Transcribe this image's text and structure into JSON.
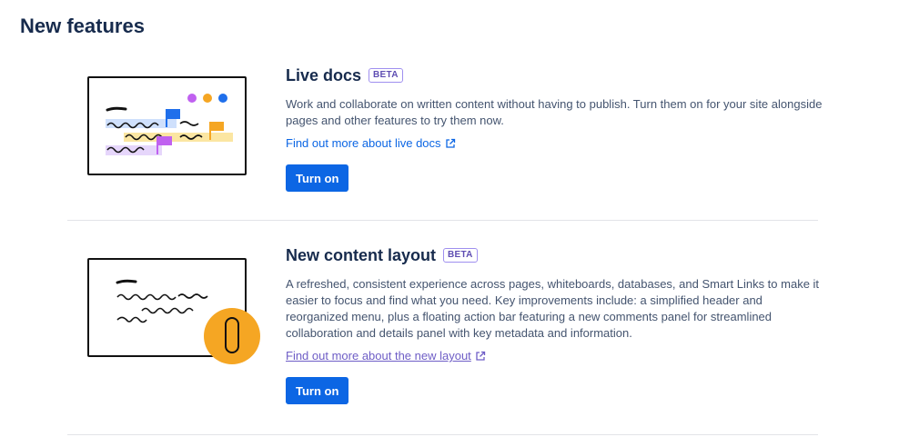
{
  "page": {
    "title": "New features"
  },
  "features": [
    {
      "title": "Live docs",
      "badge": "BETA",
      "description": "Work and collaborate on written content without having to publish. Turn them on for your site alongside pages and other features to try them now.",
      "link": "Find out more about live docs",
      "button": "Turn on",
      "illustration": "live-docs-illustration"
    },
    {
      "title": "New content layout",
      "badge": "BETA",
      "description": "A refreshed, consistent experience across pages, whiteboards, databases, and Smart Links to make it easier to focus and find what you need. Key improvements include: a simplified header and reorganized menu, plus a floating action bar featuring a new comments panel for streamlined collaboration and details panel with key metadata and information.",
      "link": "Find out more about the new layout",
      "button": "Turn on",
      "illustration": "content-layout-illustration"
    }
  ],
  "colors": {
    "primary": "#0c66e4",
    "link": "#0c66e4",
    "visited_link": "#6e5dc6",
    "badge": "#5e4db2",
    "dot_purple": "#c061f0",
    "dot_orange": "#f5a623",
    "dot_blue": "#1f6feb",
    "highlight_blue": "#cfe0fc",
    "highlight_yellow": "#fbe6a2",
    "highlight_purple": "#e6d6fb"
  }
}
